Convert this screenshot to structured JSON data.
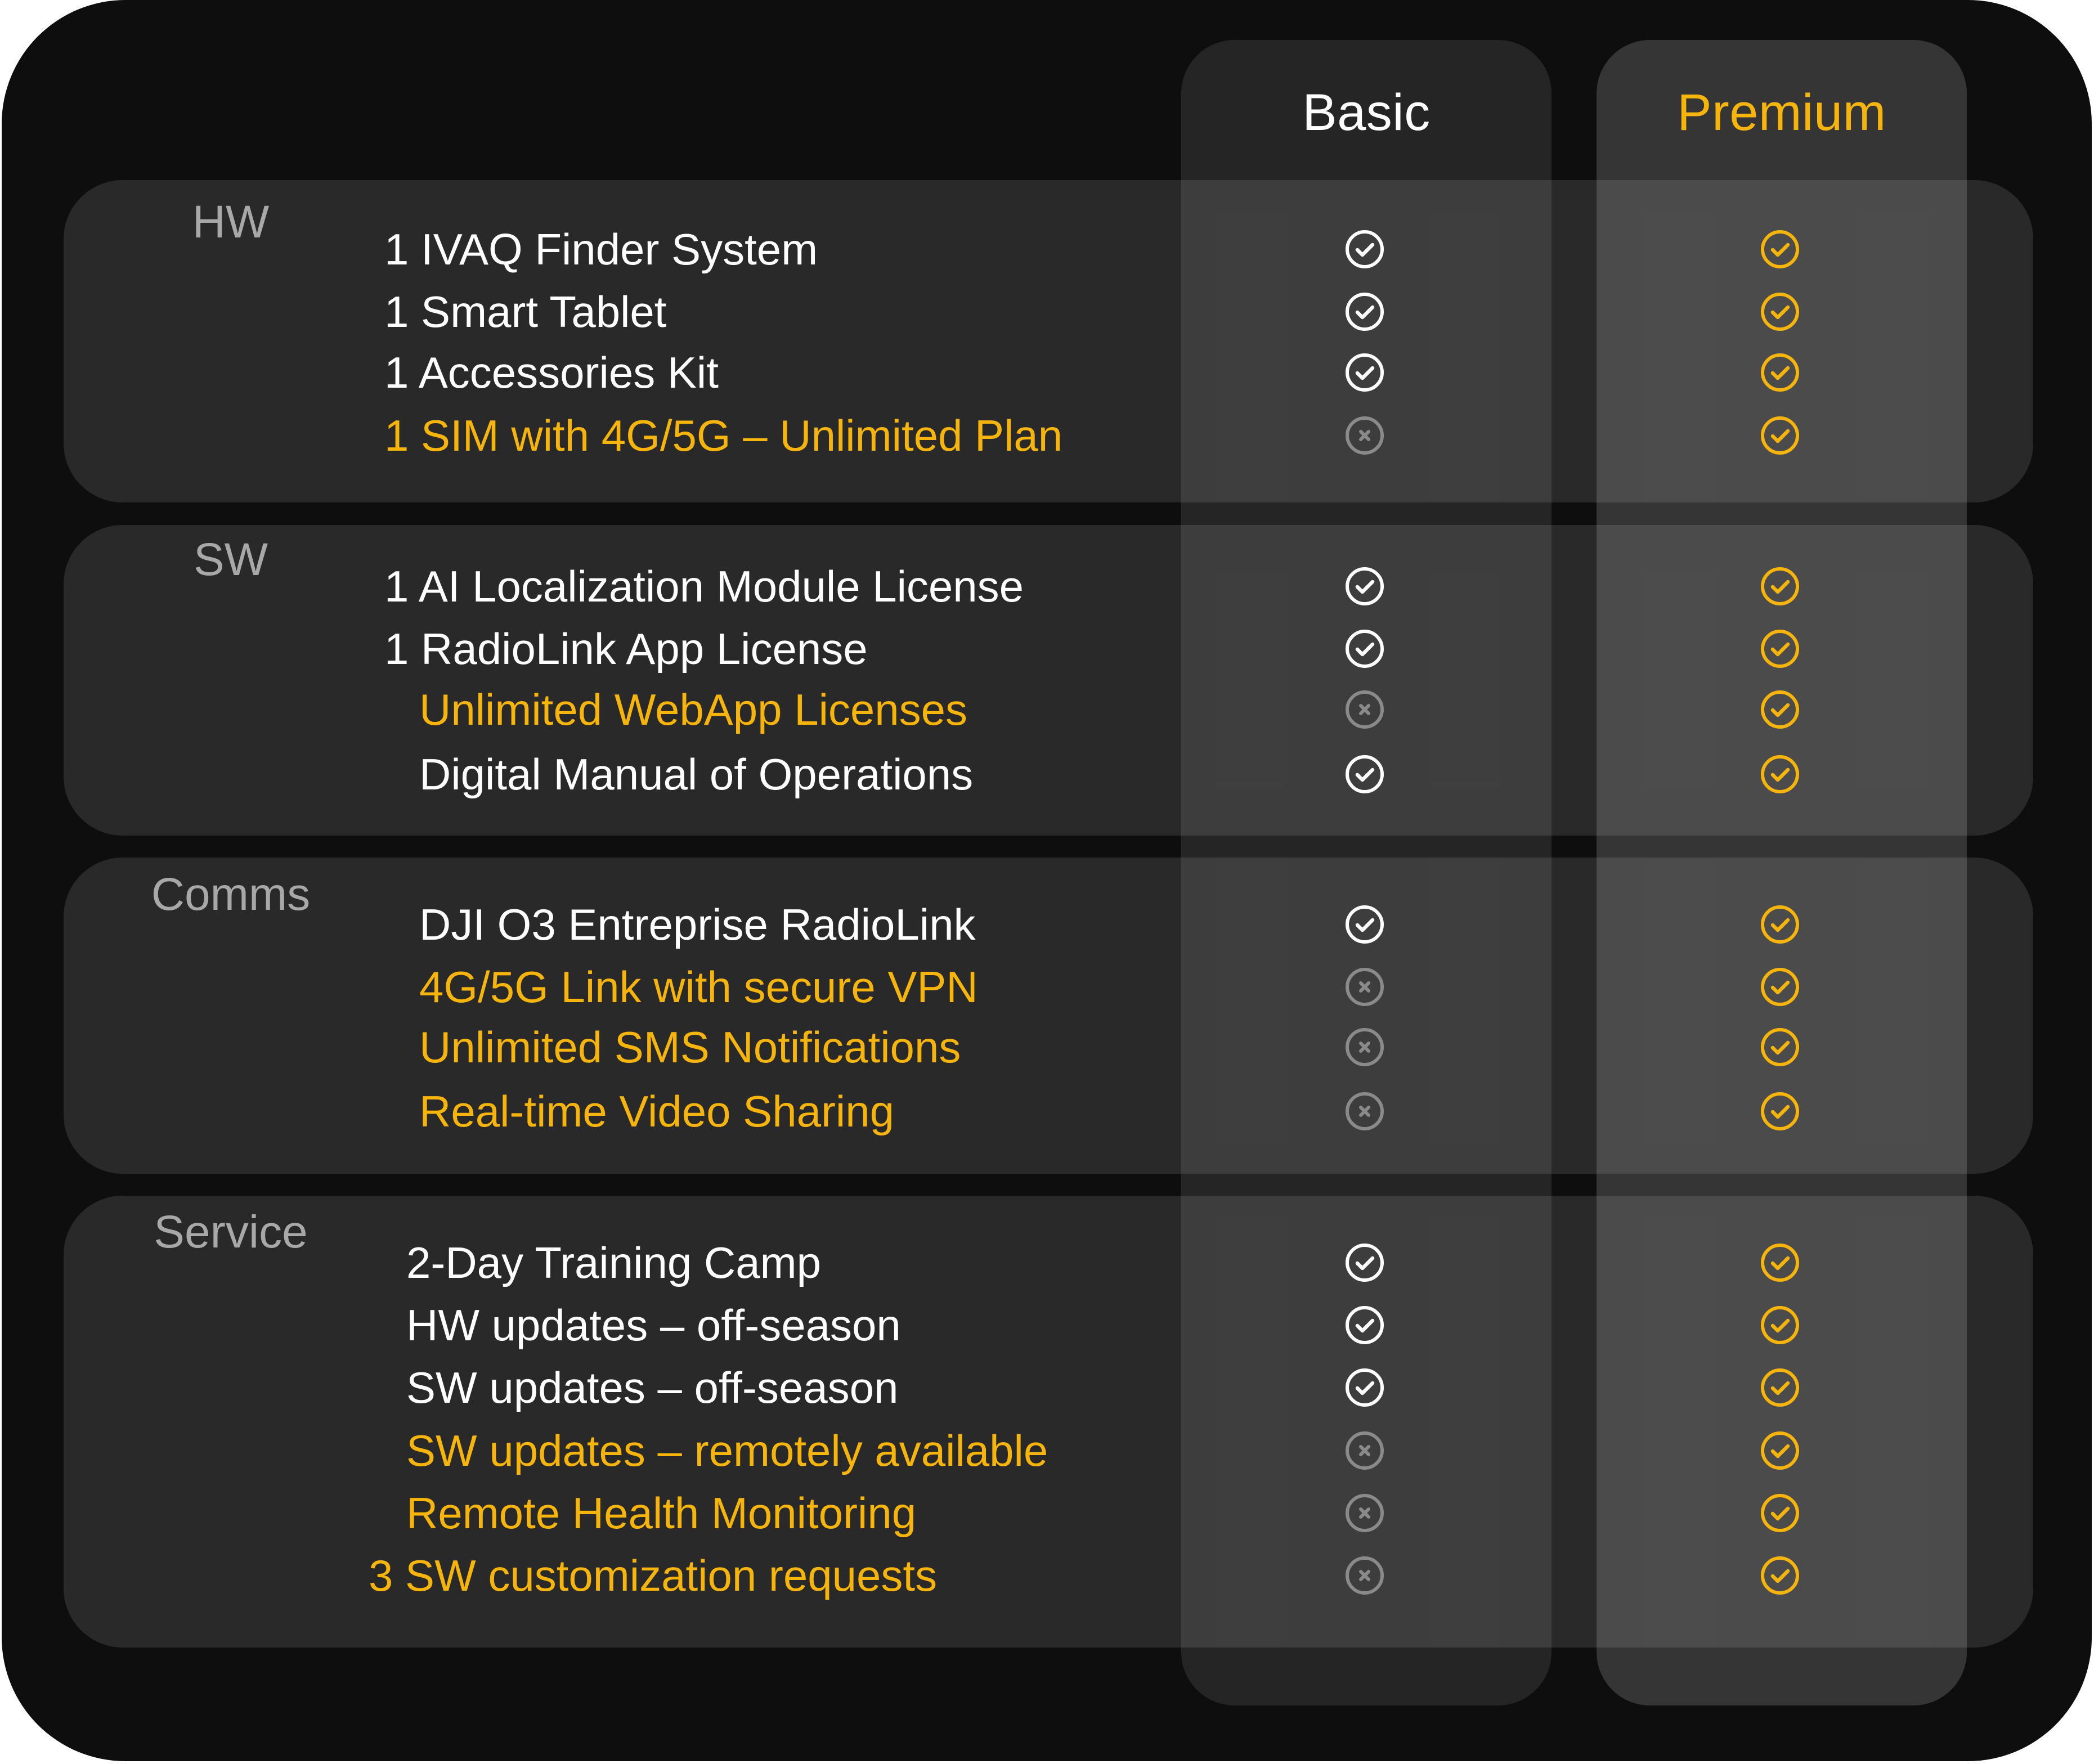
{
  "columns": {
    "basic": "Basic",
    "premium": "Premium"
  },
  "colors": {
    "background": "#0e0e0e",
    "highlight": "#f7b50c",
    "included_basic": "#ffffff",
    "excluded": "#8a8a8a"
  },
  "sections": [
    {
      "category": "HW",
      "features": [
        {
          "label": "1 IVAQ Finder System",
          "highlight": false,
          "basic": "check-icon",
          "premium": "check-icon"
        },
        {
          "label": "1 Smart Tablet",
          "highlight": false,
          "basic": "check-icon",
          "premium": "check-icon"
        },
        {
          "label": "1 Accessories Kit",
          "highlight": false,
          "basic": "check-icon",
          "premium": "check-icon"
        },
        {
          "label": "1 SIM with 4G/5G – Unlimited Plan",
          "highlight": true,
          "basic": "x-icon",
          "premium": "check-icon"
        }
      ]
    },
    {
      "category": "SW",
      "features": [
        {
          "label": "1 AI Localization Module License",
          "highlight": false,
          "basic": "check-icon",
          "premium": "check-icon"
        },
        {
          "label": "1 RadioLink App License",
          "highlight": false,
          "basic": "check-icon",
          "premium": "check-icon"
        },
        {
          "label": "Unlimited WebApp Licenses",
          "highlight": true,
          "basic": "x-icon",
          "premium": "check-icon"
        },
        {
          "label": "Digital Manual of Operations",
          "highlight": false,
          "basic": "check-icon",
          "premium": "check-icon"
        }
      ]
    },
    {
      "category": "Comms",
      "features": [
        {
          "label": "DJI O3 Entreprise RadioLink",
          "highlight": false,
          "basic": "check-icon",
          "premium": "check-icon"
        },
        {
          "label": "4G/5G Link with secure VPN",
          "highlight": true,
          "basic": "x-icon",
          "premium": "check-icon"
        },
        {
          "label": "Unlimited SMS Notifications",
          "highlight": true,
          "basic": "x-icon",
          "premium": "check-icon"
        },
        {
          "label": "Real-time Video Sharing",
          "highlight": true,
          "basic": "x-icon",
          "premium": "check-icon"
        }
      ]
    },
    {
      "category": "Service",
      "features": [
        {
          "label": "2-Day Training Camp",
          "highlight": false,
          "basic": "check-icon",
          "premium": "check-icon"
        },
        {
          "label": "HW updates – off-season",
          "highlight": false,
          "basic": "check-icon",
          "premium": "check-icon"
        },
        {
          "label": "SW updates – off-season",
          "highlight": false,
          "basic": "check-icon",
          "premium": "check-icon"
        },
        {
          "label": "SW updates – remotely available",
          "highlight": true,
          "basic": "x-icon",
          "premium": "check-icon"
        },
        {
          "label": "Remote Health Monitoring",
          "highlight": true,
          "basic": "x-icon",
          "premium": "check-icon"
        },
        {
          "label": "3 SW customization requests",
          "highlight": true,
          "basic": "x-icon",
          "premium": "check-icon"
        }
      ]
    }
  ]
}
